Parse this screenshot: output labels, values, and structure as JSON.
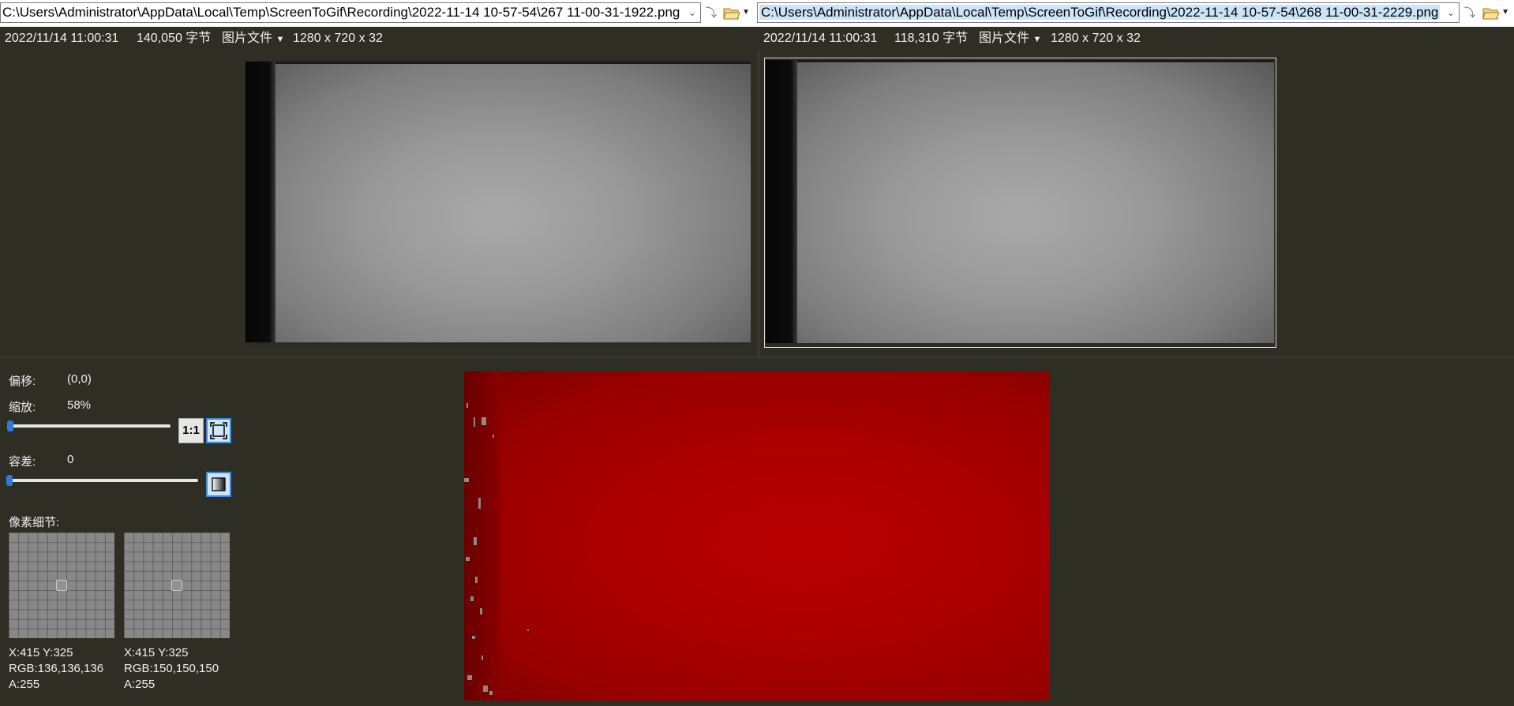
{
  "left": {
    "path": "C:\\Users\\Administrator\\AppData\\Local\\Temp\\ScreenToGif\\Recording\\2022-11-14 10-57-54\\267 11-00-31-1922.png",
    "date": "2022/11/14 11:00:31",
    "size": "140,050 字节",
    "type": "图片文件",
    "dims": "1280 x 720 x 32"
  },
  "right": {
    "path": "C:\\Users\\Administrator\\AppData\\Local\\Temp\\ScreenToGif\\Recording\\2022-11-14 10-57-54\\268 11-00-31-2229.png",
    "date": "2022/11/14 11:00:31",
    "size": "118,310 字节",
    "type": "图片文件",
    "dims": "1280 x 720 x 32"
  },
  "controls": {
    "offset_label": "偏移:",
    "offset_value": "(0,0)",
    "zoom_label": "缩放:",
    "zoom_value": "58%",
    "one_to_one": "1:1",
    "tolerance_label": "容差:",
    "tolerance_value": "0",
    "pixel_detail_label": "像素细节:"
  },
  "pixels": {
    "left": {
      "xy": "X:415 Y:325",
      "rgb": "RGB:136,136,136",
      "alpha": "A:255"
    },
    "right": {
      "xy": "X:415 Y:325",
      "rgb": "RGB:150,150,150",
      "alpha": "A:255"
    }
  },
  "icons": {
    "dropdown": "chevron-down-icon",
    "next": "next-arrow-icon",
    "folder": "folder-open-icon",
    "fit": "fit-to-window-icon",
    "gradient": "gradient-icon"
  },
  "colors": {
    "background": "#2e2e24",
    "accent": "#2f7ad8",
    "diff": "#b80000"
  }
}
